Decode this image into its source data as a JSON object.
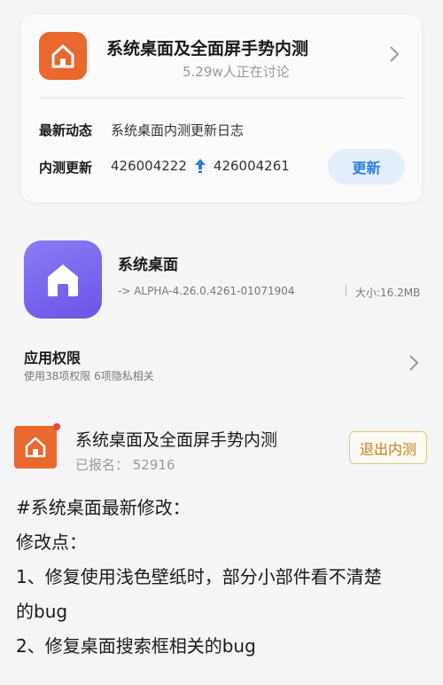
{
  "top_card": {
    "title": "系统桌面及全面屏手势内测",
    "subtitle": "5.29w人正在讨论",
    "latest_label": "最新动态",
    "latest_value": "系统桌面内测更新日志",
    "beta_update_label": "内测更新",
    "version_from": "426004222",
    "version_to": "426004261",
    "update_button": "更新"
  },
  "app_info": {
    "name": "系统桌面",
    "version": "-> ALPHA-4.26.0.4261-01071904",
    "size": "大小:16.2MB",
    "permissions_title": "应用权限",
    "permissions_sub": "使用38项权限 6项隐私相关"
  },
  "beta_section": {
    "title": "系统桌面及全面屏手势内测",
    "signup_count": "已报名： 52916",
    "exit_button": "退出内测"
  },
  "notes": [
    "#系统桌面最新修改：",
    "修改点：",
    "1、修复使用浅色壁纸时，部分小部件看不清楚",
    "的bug",
    "2、修复桌面搜索框相关的bug"
  ],
  "colors": {
    "accent_orange": "#e8682e",
    "accent_blue": "#2a7de1",
    "accent_purple": "#7462ee"
  }
}
